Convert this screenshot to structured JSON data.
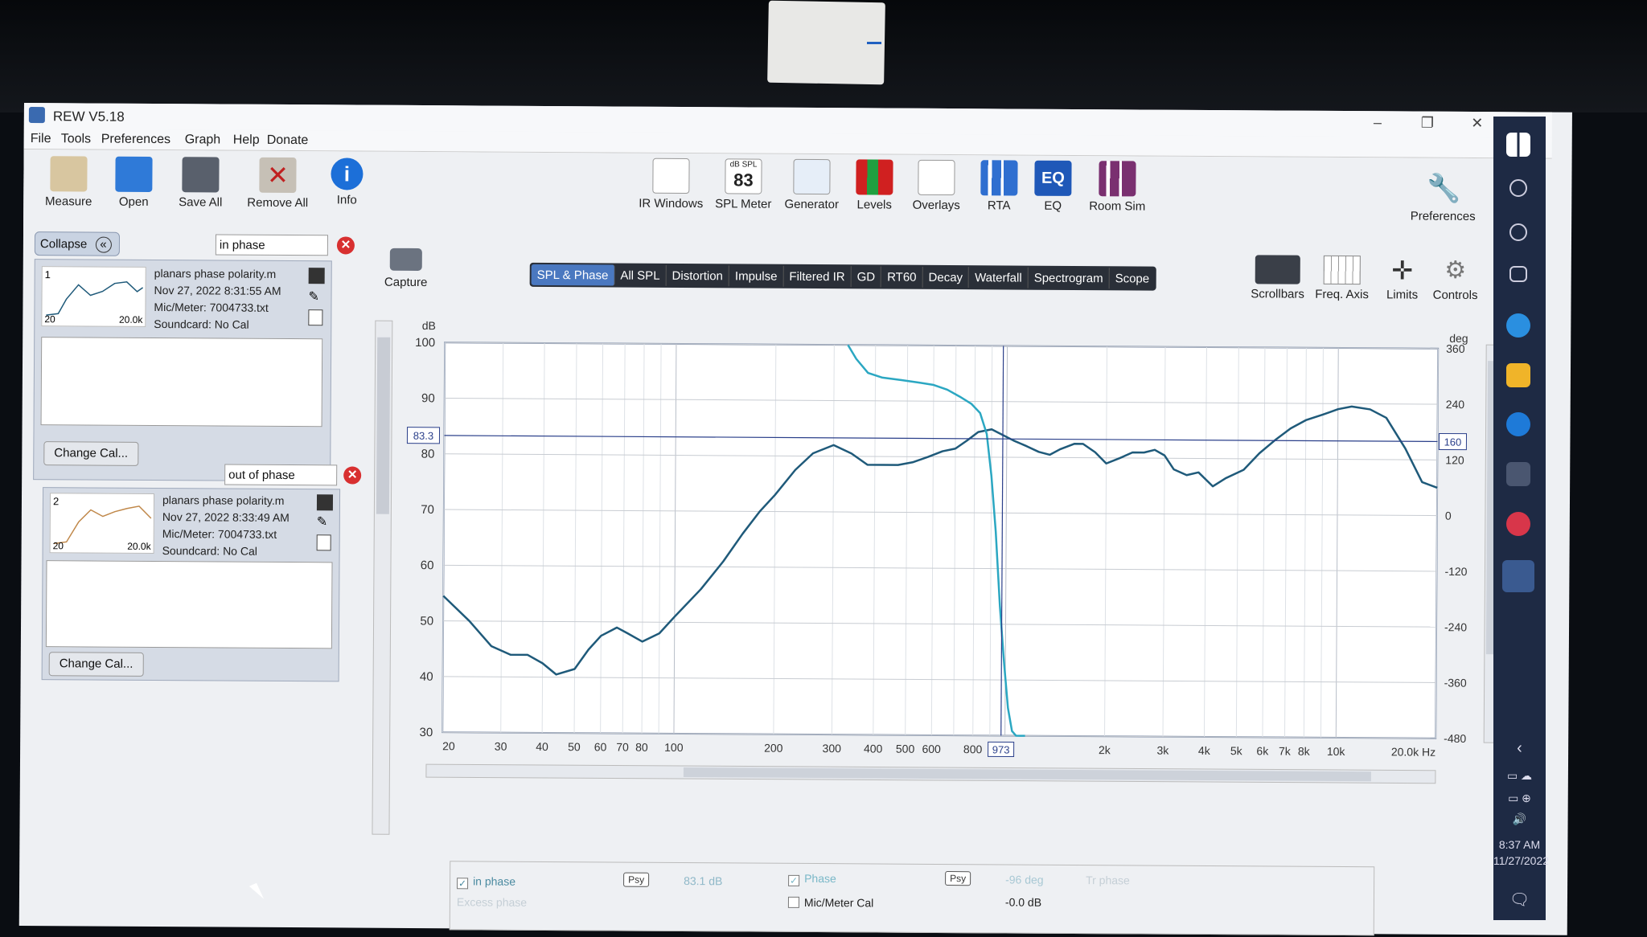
{
  "window": {
    "title": "REW V5.18"
  },
  "menu": [
    "File",
    "Tools",
    "Preferences",
    "Graph",
    "Help",
    "Donate"
  ],
  "toolbar_left": [
    {
      "label": "Measure",
      "icon": "measure-icon"
    },
    {
      "label": "Open",
      "icon": "folder-icon"
    },
    {
      "label": "Save All",
      "icon": "save-icon"
    },
    {
      "label": "Remove All",
      "icon": "remove-icon"
    },
    {
      "label": "Info",
      "icon": "info-icon"
    }
  ],
  "toolbar_center": [
    {
      "label": "IR Windows",
      "icon": "ir-windows-icon"
    },
    {
      "label": "SPL Meter",
      "icon": "spl-meter-icon",
      "badge_top": "dB SPL",
      "badge_value": "83"
    },
    {
      "label": "Generator",
      "icon": "generator-icon"
    },
    {
      "label": "Levels",
      "icon": "levels-icon"
    },
    {
      "label": "Overlays",
      "icon": "overlays-icon"
    },
    {
      "label": "RTA",
      "icon": "rta-icon"
    },
    {
      "label": "EQ",
      "icon": "eq-icon"
    },
    {
      "label": "Room Sim",
      "icon": "room-sim-icon"
    }
  ],
  "preferences_button": "Preferences",
  "panel": {
    "collapse": "Collapse",
    "collapse_glyph": "«",
    "measurements": [
      {
        "index": "1",
        "name": "in phase",
        "file": "planars phase polarity.m",
        "date": "Nov 27, 2022 8:31:55 AM",
        "mic": "Mic/Meter: 7004733.txt",
        "soundcard": "Soundcard: No Cal",
        "thumb_left": "20",
        "thumb_right": "20.0k",
        "change_cal": "Change Cal..."
      },
      {
        "index": "2",
        "name": "out of phase",
        "file": "planars phase polarity.m",
        "date": "Nov 27, 2022 8:33:49 AM",
        "mic": "Mic/Meter: 7004733.txt",
        "soundcard": "Soundcard: No Cal",
        "thumb_left": "20",
        "thumb_right": "20.0k",
        "change_cal": "Change Cal..."
      }
    ]
  },
  "capture": "Capture",
  "tabs": [
    "SPL & Phase",
    "All SPL",
    "Distortion",
    "Impulse",
    "Filtered IR",
    "GD",
    "RT60",
    "Decay",
    "Waterfall",
    "Spectrogram",
    "Scope"
  ],
  "active_tab": "SPL & Phase",
  "right_tools": [
    "Scrollbars",
    "Freq. Axis",
    "Limits",
    "Controls"
  ],
  "chart_data": {
    "type": "line",
    "y_unit_left": "dB",
    "y_unit_right": "deg",
    "x_unit": "Hz",
    "xlim": [
      20,
      20000
    ],
    "ylim": [
      30,
      100
    ],
    "y2lim": [
      -480,
      360
    ],
    "x_log": true,
    "grid": true,
    "x_ticks": [
      {
        "v": 20,
        "label": "20"
      },
      {
        "v": 30,
        "label": "30"
      },
      {
        "v": 40,
        "label": "40"
      },
      {
        "v": 50,
        "label": "50"
      },
      {
        "v": 60,
        "label": "60"
      },
      {
        "v": 70,
        "label": "70"
      },
      {
        "v": 80,
        "label": "80"
      },
      {
        "v": 100,
        "label": "100"
      },
      {
        "v": 200,
        "label": "200"
      },
      {
        "v": 300,
        "label": "300"
      },
      {
        "v": 400,
        "label": "400"
      },
      {
        "v": 500,
        "label": "500"
      },
      {
        "v": 600,
        "label": "600"
      },
      {
        "v": 800,
        "label": "800"
      },
      {
        "v": 2000,
        "label": "2k"
      },
      {
        "v": 3000,
        "label": "3k"
      },
      {
        "v": 4000,
        "label": "4k"
      },
      {
        "v": 5000,
        "label": "5k"
      },
      {
        "v": 6000,
        "label": "6k"
      },
      {
        "v": 7000,
        "label": "7k"
      },
      {
        "v": 8000,
        "label": "8k"
      },
      {
        "v": 10000,
        "label": "10k"
      },
      {
        "v": 20000,
        "label": "20.0k Hz"
      }
    ],
    "y_ticks": [
      30,
      40,
      50,
      60,
      70,
      80,
      90,
      100
    ],
    "y2_ticks": [
      -480,
      -360,
      -240,
      -120,
      0,
      120,
      240,
      360
    ],
    "cursor": {
      "freq": 973,
      "freq_label": "973",
      "spl": 83.3,
      "spl_label": "83.3",
      "phase_label": "160"
    },
    "series": [
      {
        "name": "in phase",
        "axis": "left",
        "color": "#1f5a7a",
        "x": [
          20,
          24,
          28,
          32,
          36,
          40,
          44,
          50,
          55,
          60,
          67,
          72,
          80,
          90,
          100,
          120,
          140,
          160,
          180,
          200,
          230,
          260,
          300,
          340,
          380,
          420,
          470,
          520,
          580,
          640,
          700,
          760,
          820,
          900,
          973,
          1050,
          1150,
          1250,
          1350,
          1450,
          1600,
          1700,
          1850,
          2000,
          2200,
          2400,
          2600,
          2800,
          3000,
          3200,
          3500,
          3800,
          4200,
          4600,
          5200,
          5800,
          6500,
          7200,
          8000,
          9000,
          10000,
          11000,
          12500,
          14000,
          16000,
          18000,
          20000
        ],
        "y": [
          54.5,
          50,
          45.5,
          44,
          44,
          42.5,
          40.5,
          41.5,
          45,
          47.5,
          49,
          48,
          46.5,
          48,
          51,
          56,
          61,
          66,
          70,
          73,
          77.5,
          80.5,
          82,
          80.5,
          78.5,
          78.5,
          78.5,
          79,
          80,
          81,
          81.5,
          83,
          84.5,
          85,
          84,
          83,
          82,
          81,
          80.5,
          81.5,
          82.5,
          82.5,
          81,
          79,
          80,
          81,
          81,
          81.5,
          80.5,
          78,
          77,
          77.5,
          75,
          76.5,
          78,
          81,
          83.5,
          85.5,
          87,
          88,
          89,
          89.5,
          89,
          87.5,
          82,
          76,
          75
        ]
      },
      {
        "name": "Phase",
        "axis": "right",
        "color": "#2ba7c2",
        "x": [
          330,
          350,
          380,
          420,
          480,
          540,
          600,
          660,
          720,
          780,
          830,
          870,
          900,
          930,
          960,
          990,
          1020,
          1050,
          1080,
          1110,
          1150
        ],
        "y": [
          360,
          330,
          300,
          290,
          285,
          280,
          275,
          265,
          250,
          235,
          215,
          170,
          80,
          -40,
          -200,
          -320,
          -420,
          -470,
          -480,
          -480,
          -480
        ]
      }
    ]
  },
  "legend": {
    "in_phase_label": "in phase",
    "in_phase_value": "83.1 dB",
    "phase_label": "Phase",
    "phase_value": "-96 deg",
    "mic_label": "Mic/Meter Cal",
    "mic_value": "-0.0 dB",
    "psy": "Psy",
    "faded_1": "Tr phase",
    "faded_2": "Excess phase"
  },
  "taskbar": {
    "time": "8:37 AM",
    "date": "11/27/2022"
  }
}
